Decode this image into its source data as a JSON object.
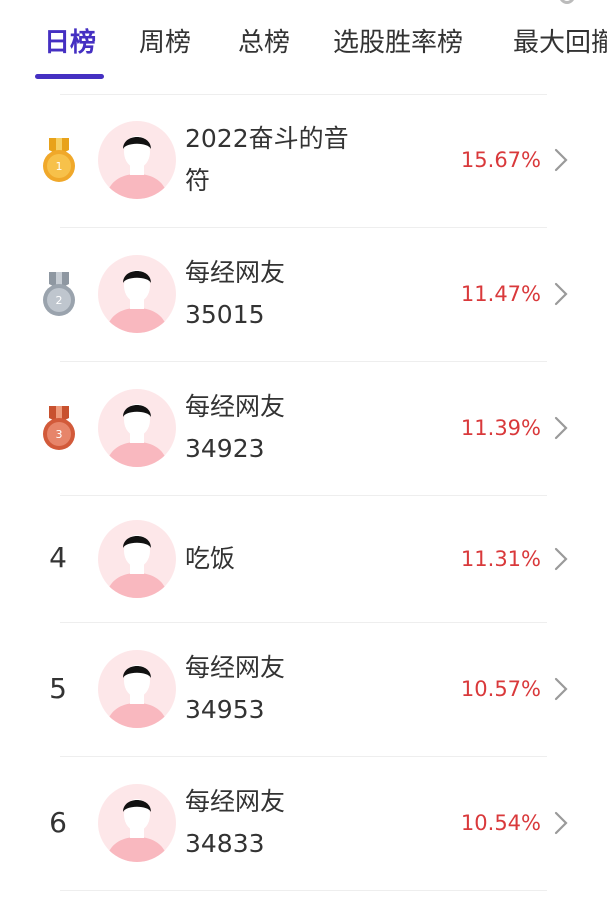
{
  "tabs": [
    {
      "label": "日榜",
      "active": true
    },
    {
      "label": "周榜",
      "active": false
    },
    {
      "label": "总榜",
      "active": false
    },
    {
      "label": "选股胜率榜",
      "active": false
    },
    {
      "label": "最大回撤",
      "active": false
    }
  ],
  "colors": {
    "accent": "#4530c2",
    "return_red": "#d9393b",
    "gold": "#e8a21a",
    "silver": "#9aa3ad",
    "bronze": "#d25a3a"
  },
  "ranking": [
    {
      "rank": "1",
      "medal": "gold",
      "name_line1": "2022奋斗的音",
      "name_line2": "符",
      "value": "15.67%"
    },
    {
      "rank": "2",
      "medal": "silver",
      "name_line1": "每经网友",
      "name_line2": "35015",
      "value": "11.47%"
    },
    {
      "rank": "3",
      "medal": "bronze",
      "name_line1": "每经网友",
      "name_line2": "34923",
      "value": "11.39%"
    },
    {
      "rank": "4",
      "medal": null,
      "name_line1": "吃饭",
      "name_line2": "",
      "value": "11.31%"
    },
    {
      "rank": "5",
      "medal": null,
      "name_line1": "每经网友",
      "name_line2": "34953",
      "value": "10.57%"
    },
    {
      "rank": "6",
      "medal": null,
      "name_line1": "每经网友",
      "name_line2": "34833",
      "value": "10.54%"
    }
  ]
}
